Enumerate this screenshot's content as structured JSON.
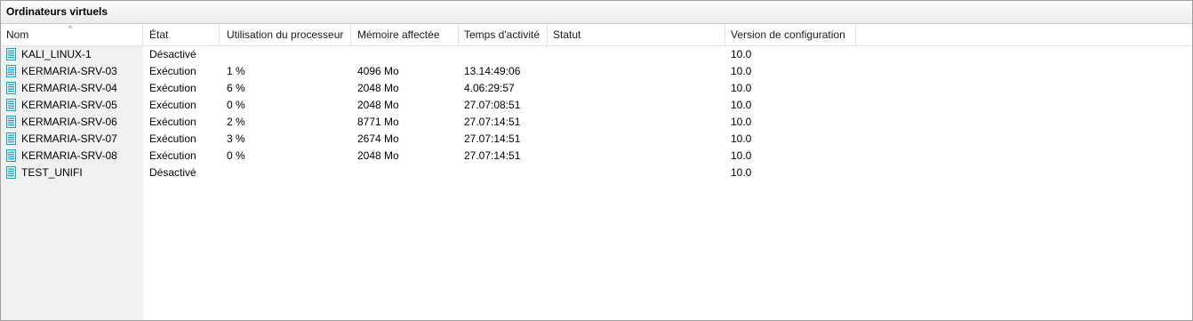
{
  "panel": {
    "title": "Ordinateurs virtuels"
  },
  "columns": {
    "name": "Nom",
    "state": "État",
    "cpu": "Utilisation du processeur",
    "memory": "Mémoire affectée",
    "uptime": "Temps d'activité",
    "status": "Statut",
    "config_version": "Version de configuration"
  },
  "sort": {
    "column": "name",
    "icon": "sort-ascending-icon",
    "glyph": "^"
  },
  "icons": {
    "vm": "virtual-machine-icon",
    "vm_color": "#1e9fc6"
  },
  "rows": [
    {
      "name": "KALI_LINUX-1",
      "state": "Désactivé",
      "cpu": "",
      "memory": "",
      "uptime": "",
      "status": "",
      "config_version": "10.0"
    },
    {
      "name": "KERMARIA-SRV-03",
      "state": "Exécution",
      "cpu": "1 %",
      "memory": "4096 Mo",
      "uptime": "13.14:49:06",
      "status": "",
      "config_version": "10.0"
    },
    {
      "name": "KERMARIA-SRV-04",
      "state": "Exécution",
      "cpu": "6 %",
      "memory": "2048 Mo",
      "uptime": "4.06:29:57",
      "status": "",
      "config_version": "10.0"
    },
    {
      "name": "KERMARIA-SRV-05",
      "state": "Exécution",
      "cpu": "0 %",
      "memory": "2048 Mo",
      "uptime": "27.07:08:51",
      "status": "",
      "config_version": "10.0"
    },
    {
      "name": "KERMARIA-SRV-06",
      "state": "Exécution",
      "cpu": "2 %",
      "memory": "8771 Mo",
      "uptime": "27.07:14:51",
      "status": "",
      "config_version": "10.0"
    },
    {
      "name": "KERMARIA-SRV-07",
      "state": "Exécution",
      "cpu": "3 %",
      "memory": "2674 Mo",
      "uptime": "27.07:14:51",
      "status": "",
      "config_version": "10.0"
    },
    {
      "name": "KERMARIA-SRV-08",
      "state": "Exécution",
      "cpu": "0 %",
      "memory": "2048 Mo",
      "uptime": "27.07:14:51",
      "status": "",
      "config_version": "10.0"
    },
    {
      "name": "TEST_UNIFI",
      "state": "Désactivé",
      "cpu": "",
      "memory": "",
      "uptime": "",
      "status": "",
      "config_version": "10.0"
    }
  ]
}
